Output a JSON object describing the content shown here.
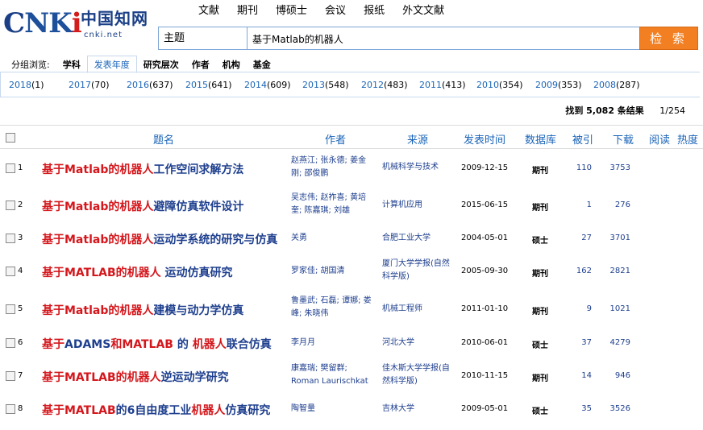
{
  "logo": {
    "brand": "CNKi",
    "chinese": "中国知网",
    "url": "cnki.net"
  },
  "topnav": [
    "文献",
    "期刊",
    "博硕士",
    "会议",
    "报纸",
    "外文文献"
  ],
  "search": {
    "field": "主题",
    "query": "基于Matlab的机器人",
    "button": "检 索"
  },
  "groups": {
    "label": "分组浏览:",
    "items": [
      "学科",
      "发表年度",
      "研究层次",
      "作者",
      "机构",
      "基金"
    ],
    "selected": "发表年度"
  },
  "years": [
    {
      "year": "2018",
      "count": "(1)"
    },
    {
      "year": "2017",
      "count": "(70)"
    },
    {
      "year": "2016",
      "count": "(637)"
    },
    {
      "year": "2015",
      "count": "(641)"
    },
    {
      "year": "2014",
      "count": "(609)"
    },
    {
      "year": "2013",
      "count": "(548)"
    },
    {
      "year": "2012",
      "count": "(483)"
    },
    {
      "year": "2011",
      "count": "(413)"
    },
    {
      "year": "2010",
      "count": "(354)"
    },
    {
      "year": "2009",
      "count": "(353)"
    },
    {
      "year": "2008",
      "count": "(287)"
    }
  ],
  "summary": {
    "found": "找到 5,082 条结果",
    "page": "1/254"
  },
  "columns": {
    "title": "题名",
    "author": "作者",
    "source": "来源",
    "date": "发表时间",
    "db": "数据库",
    "cited": "被引",
    "download": "下载",
    "read": "阅读",
    "heat": "热度"
  },
  "rows": [
    {
      "num": "1",
      "title_hl": "基于Matlab的机器人",
      "title_rest": "工作空间求解方法",
      "author": "赵燕江; 张永德; 姜金刚; 邵俊鹏",
      "source": "机械科学与技术",
      "date": "2009-12-15",
      "db": "期刊",
      "cited": "110",
      "download": "3753"
    },
    {
      "num": "2",
      "title_hl": "基于Matlab的机器人",
      "title_rest": "避障仿真软件设计",
      "author": "吴志伟; 赵祚喜; 黄培奎; 陈嘉琪; 刘雄",
      "source": "计算机应用",
      "date": "2015-06-15",
      "db": "期刊",
      "cited": "1",
      "download": "276"
    },
    {
      "num": "3",
      "title_hl": "基于Matlab的机器人",
      "title_rest": "运动学系统的研究与仿真",
      "author": "关勇",
      "source": "合肥工业大学",
      "date": "2004-05-01",
      "db": "硕士",
      "cited": "27",
      "download": "3701"
    },
    {
      "num": "4",
      "title_hl": "基于MATLAB的机器人",
      "title_rest": "运动仿真研究",
      "author": "罗家佳; 胡国清",
      "source": "厦门大学学报(自然科学版)",
      "date": "2005-09-30",
      "db": "期刊",
      "cited": "162",
      "download": "2821"
    },
    {
      "num": "5",
      "title_hl": "基于Matlab的机器人",
      "title_rest": "建模与动力学仿真",
      "author": "鲁墨武; 石磊; 谭娜; 娄峰; 朱晓伟",
      "source": "机械工程师",
      "date": "2011-01-10",
      "db": "期刊",
      "cited": "9",
      "download": "1021"
    },
    {
      "num": "6",
      "title_parts": [
        [
          "基于",
          "hl"
        ],
        [
          "ADAMS",
          "plain"
        ],
        [
          "和",
          "hl"
        ],
        [
          "MATLAB",
          "hl"
        ],
        [
          "的",
          "plain"
        ],
        [
          "机器人",
          "hl"
        ],
        [
          "联合仿真",
          "plain"
        ]
      ],
      "author": "李月月",
      "source": "河北大学",
      "date": "2010-06-01",
      "db": "硕士",
      "cited": "37",
      "download": "4279"
    },
    {
      "num": "7",
      "title_hl": "基于MATLAB的机器人",
      "title_rest": "逆运动学研究",
      "author": "康嘉瑞; 樊留群; Roman Laurischkat",
      "source": "佳木斯大学学报(自然科学版)",
      "date": "2010-11-15",
      "db": "期刊",
      "cited": "14",
      "download": "946"
    },
    {
      "num": "8",
      "title_parts": [
        [
          "基于",
          "hl"
        ],
        [
          "MATLAB",
          "hl"
        ],
        [
          "的6自由度工业",
          "plain"
        ],
        [
          "机器人",
          "hl"
        ],
        [
          "仿真研究",
          "plain"
        ]
      ],
      "author": "陶智量",
      "source": "吉林大学",
      "date": "2009-05-01",
      "db": "硕士",
      "cited": "35",
      "download": "3526"
    }
  ]
}
